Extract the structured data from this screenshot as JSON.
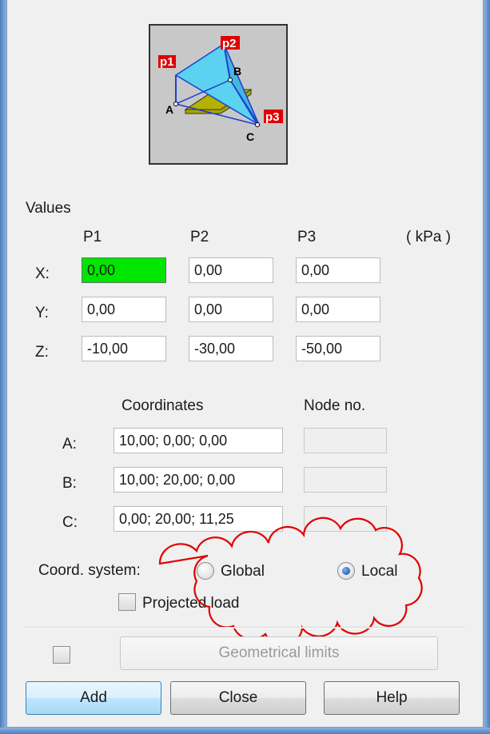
{
  "values_section": {
    "title": "Values",
    "columns": [
      "P1",
      "P2",
      "P3"
    ],
    "unit": "( kPa )",
    "rows": [
      {
        "label": "X:",
        "values": [
          "0,00",
          "0,00",
          "0,00"
        ]
      },
      {
        "label": "Y:",
        "values": [
          "0,00",
          "0,00",
          "0,00"
        ]
      },
      {
        "label": "Z:",
        "values": [
          "-10,00",
          "-30,00",
          "-50,00"
        ]
      }
    ]
  },
  "diagram": {
    "labels": {
      "p1": "p1",
      "p2": "p2",
      "p3": "p3",
      "a": "A",
      "b": "B",
      "c": "C"
    }
  },
  "coordinates_section": {
    "coord_header": "Coordinates",
    "node_header": "Node no.",
    "points": [
      {
        "label": "A:",
        "coords": "10,00; 0,00; 0,00",
        "node": ""
      },
      {
        "label": "B:",
        "coords": "10,00; 20,00; 0,00",
        "node": ""
      },
      {
        "label": "C:",
        "coords": "0,00; 20,00; 11,25",
        "node": ""
      }
    ]
  },
  "coord_system": {
    "label": "Coord. system:",
    "options": [
      "Global",
      "Local"
    ],
    "selected": "Local"
  },
  "projected_load": {
    "label": "Projected load",
    "checked": false
  },
  "geometrical_limits": {
    "label": "Geometrical limits",
    "checked": false
  },
  "buttons": {
    "add": "Add",
    "close": "Close",
    "help": "Help"
  },
  "colors": {
    "active_field": "#00e600",
    "annotation": "#e00000",
    "plane": "#5ad2f0",
    "slab": "#a9a400"
  }
}
